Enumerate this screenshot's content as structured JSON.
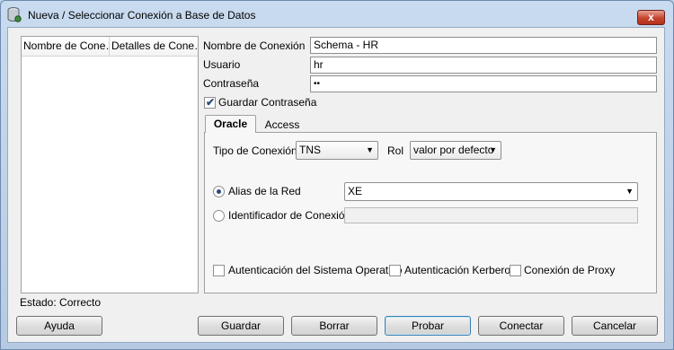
{
  "window": {
    "title": "Nueva / Seleccionar Conexión a Base de Datos",
    "close_glyph": "x"
  },
  "connections_list": {
    "columns": [
      "Nombre de Cone…",
      "Detalles de Cone…"
    ]
  },
  "form": {
    "connection_name_label": "Nombre de Conexión",
    "connection_name_value": "Schema - HR",
    "user_label": "Usuario",
    "user_value": "hr",
    "password_label": "Contraseña",
    "password_value": "••",
    "save_password_label": "Guardar Contraseña",
    "save_password_checked": true
  },
  "tabs": [
    {
      "label": "Oracle",
      "active": true
    },
    {
      "label": "Access",
      "active": false
    }
  ],
  "oracle": {
    "connection_type_label": "Tipo de Conexión",
    "connection_type_value": "TNS",
    "role_label": "Rol",
    "role_value": "valor por defecto",
    "network_alias_label": "Alias de la Red",
    "network_alias_value": "XE",
    "network_alias_selected": true,
    "connect_identifier_label": "Identificador de Conexión",
    "connect_identifier_selected": false,
    "os_auth_label": "Autenticación del Sistema Operativo",
    "kerberos_auth_label": "Autenticación Kerberos",
    "proxy_connection_label": "Conexión de Proxy"
  },
  "status": {
    "text": "Estado: Correcto"
  },
  "buttons": {
    "help": "Ayuda",
    "save": "Guardar",
    "clear": "Borrar",
    "test": "Probar",
    "connect": "Conectar",
    "cancel": "Cancelar"
  },
  "icons": {
    "app": "database-icon",
    "dropdown": "▼",
    "check": "✔"
  }
}
